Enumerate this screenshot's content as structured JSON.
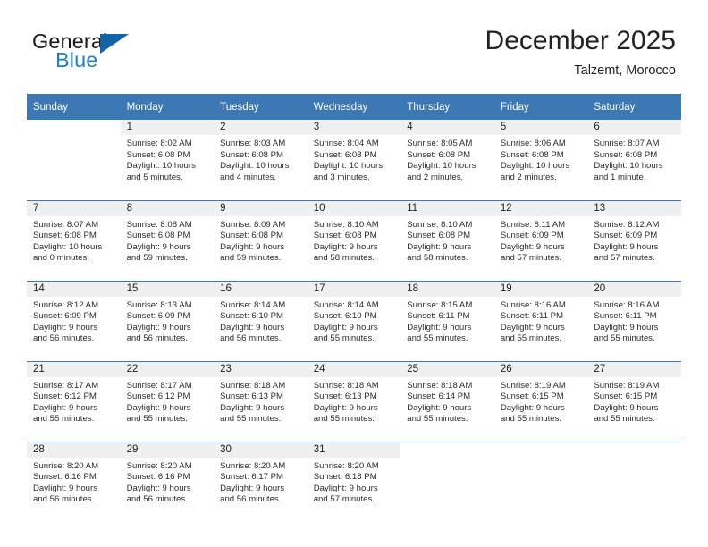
{
  "brand": {
    "name_part1": "General",
    "name_part2": "Blue",
    "accent_color": "#1f7fc4",
    "triangle_color": "#1263a8",
    "triangle_icon": "triangle-icon"
  },
  "header": {
    "title": "December 2025",
    "subtitle": "Talzemt, Morocco"
  },
  "theme": {
    "header_blue": "#3c78b4",
    "daynum_band": "#f0f0f0",
    "text": "#222222"
  },
  "weekdays": [
    "Sunday",
    "Monday",
    "Tuesday",
    "Wednesday",
    "Thursday",
    "Friday",
    "Saturday"
  ],
  "weeks": [
    [
      {
        "day": "",
        "sunrise": "",
        "sunset": "",
        "daylight_line1": "",
        "daylight_line2": "",
        "blank": true
      },
      {
        "day": "1",
        "sunrise": "Sunrise: 8:02 AM",
        "sunset": "Sunset: 6:08 PM",
        "daylight_line1": "Daylight: 10 hours",
        "daylight_line2": "and 5 minutes."
      },
      {
        "day": "2",
        "sunrise": "Sunrise: 8:03 AM",
        "sunset": "Sunset: 6:08 PM",
        "daylight_line1": "Daylight: 10 hours",
        "daylight_line2": "and 4 minutes."
      },
      {
        "day": "3",
        "sunrise": "Sunrise: 8:04 AM",
        "sunset": "Sunset: 6:08 PM",
        "daylight_line1": "Daylight: 10 hours",
        "daylight_line2": "and 3 minutes."
      },
      {
        "day": "4",
        "sunrise": "Sunrise: 8:05 AM",
        "sunset": "Sunset: 6:08 PM",
        "daylight_line1": "Daylight: 10 hours",
        "daylight_line2": "and 2 minutes."
      },
      {
        "day": "5",
        "sunrise": "Sunrise: 8:06 AM",
        "sunset": "Sunset: 6:08 PM",
        "daylight_line1": "Daylight: 10 hours",
        "daylight_line2": "and 2 minutes."
      },
      {
        "day": "6",
        "sunrise": "Sunrise: 8:07 AM",
        "sunset": "Sunset: 6:08 PM",
        "daylight_line1": "Daylight: 10 hours",
        "daylight_line2": "and 1 minute."
      }
    ],
    [
      {
        "day": "7",
        "sunrise": "Sunrise: 8:07 AM",
        "sunset": "Sunset: 6:08 PM",
        "daylight_line1": "Daylight: 10 hours",
        "daylight_line2": "and 0 minutes."
      },
      {
        "day": "8",
        "sunrise": "Sunrise: 8:08 AM",
        "sunset": "Sunset: 6:08 PM",
        "daylight_line1": "Daylight: 9 hours",
        "daylight_line2": "and 59 minutes."
      },
      {
        "day": "9",
        "sunrise": "Sunrise: 8:09 AM",
        "sunset": "Sunset: 6:08 PM",
        "daylight_line1": "Daylight: 9 hours",
        "daylight_line2": "and 59 minutes."
      },
      {
        "day": "10",
        "sunrise": "Sunrise: 8:10 AM",
        "sunset": "Sunset: 6:08 PM",
        "daylight_line1": "Daylight: 9 hours",
        "daylight_line2": "and 58 minutes."
      },
      {
        "day": "11",
        "sunrise": "Sunrise: 8:10 AM",
        "sunset": "Sunset: 6:08 PM",
        "daylight_line1": "Daylight: 9 hours",
        "daylight_line2": "and 58 minutes."
      },
      {
        "day": "12",
        "sunrise": "Sunrise: 8:11 AM",
        "sunset": "Sunset: 6:09 PM",
        "daylight_line1": "Daylight: 9 hours",
        "daylight_line2": "and 57 minutes."
      },
      {
        "day": "13",
        "sunrise": "Sunrise: 8:12 AM",
        "sunset": "Sunset: 6:09 PM",
        "daylight_line1": "Daylight: 9 hours",
        "daylight_line2": "and 57 minutes."
      }
    ],
    [
      {
        "day": "14",
        "sunrise": "Sunrise: 8:12 AM",
        "sunset": "Sunset: 6:09 PM",
        "daylight_line1": "Daylight: 9 hours",
        "daylight_line2": "and 56 minutes."
      },
      {
        "day": "15",
        "sunrise": "Sunrise: 8:13 AM",
        "sunset": "Sunset: 6:09 PM",
        "daylight_line1": "Daylight: 9 hours",
        "daylight_line2": "and 56 minutes."
      },
      {
        "day": "16",
        "sunrise": "Sunrise: 8:14 AM",
        "sunset": "Sunset: 6:10 PM",
        "daylight_line1": "Daylight: 9 hours",
        "daylight_line2": "and 56 minutes."
      },
      {
        "day": "17",
        "sunrise": "Sunrise: 8:14 AM",
        "sunset": "Sunset: 6:10 PM",
        "daylight_line1": "Daylight: 9 hours",
        "daylight_line2": "and 55 minutes."
      },
      {
        "day": "18",
        "sunrise": "Sunrise: 8:15 AM",
        "sunset": "Sunset: 6:11 PM",
        "daylight_line1": "Daylight: 9 hours",
        "daylight_line2": "and 55 minutes."
      },
      {
        "day": "19",
        "sunrise": "Sunrise: 8:16 AM",
        "sunset": "Sunset: 6:11 PM",
        "daylight_line1": "Daylight: 9 hours",
        "daylight_line2": "and 55 minutes."
      },
      {
        "day": "20",
        "sunrise": "Sunrise: 8:16 AM",
        "sunset": "Sunset: 6:11 PM",
        "daylight_line1": "Daylight: 9 hours",
        "daylight_line2": "and 55 minutes."
      }
    ],
    [
      {
        "day": "21",
        "sunrise": "Sunrise: 8:17 AM",
        "sunset": "Sunset: 6:12 PM",
        "daylight_line1": "Daylight: 9 hours",
        "daylight_line2": "and 55 minutes."
      },
      {
        "day": "22",
        "sunrise": "Sunrise: 8:17 AM",
        "sunset": "Sunset: 6:12 PM",
        "daylight_line1": "Daylight: 9 hours",
        "daylight_line2": "and 55 minutes."
      },
      {
        "day": "23",
        "sunrise": "Sunrise: 8:18 AM",
        "sunset": "Sunset: 6:13 PM",
        "daylight_line1": "Daylight: 9 hours",
        "daylight_line2": "and 55 minutes."
      },
      {
        "day": "24",
        "sunrise": "Sunrise: 8:18 AM",
        "sunset": "Sunset: 6:13 PM",
        "daylight_line1": "Daylight: 9 hours",
        "daylight_line2": "and 55 minutes."
      },
      {
        "day": "25",
        "sunrise": "Sunrise: 8:18 AM",
        "sunset": "Sunset: 6:14 PM",
        "daylight_line1": "Daylight: 9 hours",
        "daylight_line2": "and 55 minutes."
      },
      {
        "day": "26",
        "sunrise": "Sunrise: 8:19 AM",
        "sunset": "Sunset: 6:15 PM",
        "daylight_line1": "Daylight: 9 hours",
        "daylight_line2": "and 55 minutes."
      },
      {
        "day": "27",
        "sunrise": "Sunrise: 8:19 AM",
        "sunset": "Sunset: 6:15 PM",
        "daylight_line1": "Daylight: 9 hours",
        "daylight_line2": "and 55 minutes."
      }
    ],
    [
      {
        "day": "28",
        "sunrise": "Sunrise: 8:20 AM",
        "sunset": "Sunset: 6:16 PM",
        "daylight_line1": "Daylight: 9 hours",
        "daylight_line2": "and 56 minutes."
      },
      {
        "day": "29",
        "sunrise": "Sunrise: 8:20 AM",
        "sunset": "Sunset: 6:16 PM",
        "daylight_line1": "Daylight: 9 hours",
        "daylight_line2": "and 56 minutes."
      },
      {
        "day": "30",
        "sunrise": "Sunrise: 8:20 AM",
        "sunset": "Sunset: 6:17 PM",
        "daylight_line1": "Daylight: 9 hours",
        "daylight_line2": "and 56 minutes."
      },
      {
        "day": "31",
        "sunrise": "Sunrise: 8:20 AM",
        "sunset": "Sunset: 6:18 PM",
        "daylight_line1": "Daylight: 9 hours",
        "daylight_line2": "and 57 minutes."
      },
      {
        "day": "",
        "sunrise": "",
        "sunset": "",
        "daylight_line1": "",
        "daylight_line2": "",
        "blank": true
      },
      {
        "day": "",
        "sunrise": "",
        "sunset": "",
        "daylight_line1": "",
        "daylight_line2": "",
        "blank": true
      },
      {
        "day": "",
        "sunrise": "",
        "sunset": "",
        "daylight_line1": "",
        "daylight_line2": "",
        "blank": true
      }
    ]
  ]
}
